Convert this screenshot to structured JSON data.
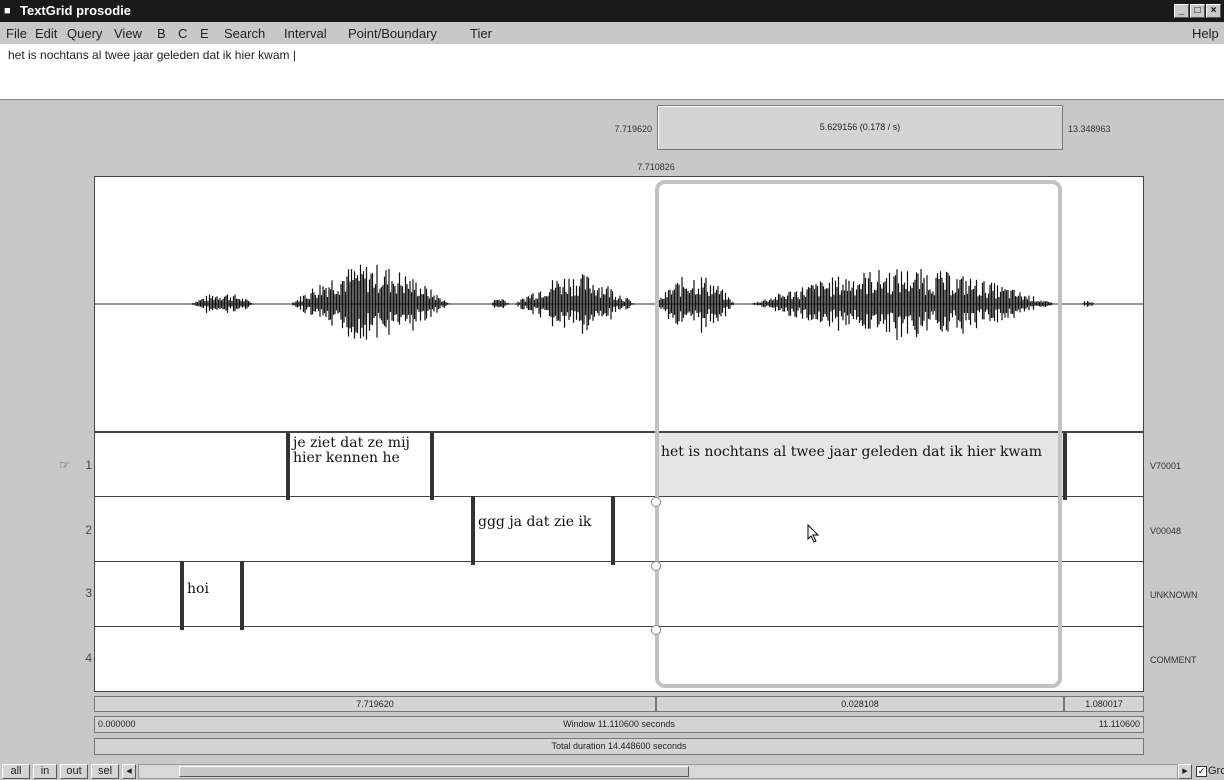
{
  "window": {
    "title": "TextGrid prosodie",
    "minimize_label": "_",
    "restore_label": "□",
    "close_label": "×"
  },
  "menu": [
    "File",
    "Edit",
    "Query",
    "View",
    "B",
    "C",
    "E",
    "Search",
    "Interval",
    "Point/Boundary",
    "Tier"
  ],
  "menu_help": "Help",
  "text_entry": {
    "value": "het is nochtans al twee jaar geleden dat ik hier kwam |"
  },
  "selection": {
    "start_label": "7.719620",
    "end_label": "13.348963",
    "center_label": "5.629156 (0.178 / s)",
    "cursor_label": "7.710826"
  },
  "tiers": [
    {
      "num": "1",
      "name": "V70001",
      "marker": "☞",
      "intervals": [
        {
          "text": "je ziet dat ze mij hier kennen he"
        },
        {
          "text": "het is nochtans al twee jaar geleden dat ik hier kwam"
        }
      ]
    },
    {
      "num": "2",
      "name": "V00048",
      "intervals": [
        {
          "text": "ggg ja dat zie ik"
        }
      ]
    },
    {
      "num": "3",
      "name": "UNKNOWN",
      "intervals": [
        {
          "text": "hoi"
        }
      ]
    },
    {
      "num": "4",
      "name": "COMMENT",
      "intervals": []
    }
  ],
  "duration_bar": {
    "left": "7.719620",
    "mid": "0.028108",
    "right": "1.080017"
  },
  "window_bar": {
    "start": "0.000000",
    "label": "Window 11.110600 seconds",
    "end": "11.110600"
  },
  "total_bar": {
    "label": "Total duration 14.448600 seconds"
  },
  "bottom_buttons": [
    "all",
    "in",
    "out",
    "sel"
  ],
  "scroll_left": "◂",
  "scroll_right": "▸",
  "group": {
    "label": "Group",
    "checked": true,
    "check": "✓"
  }
}
